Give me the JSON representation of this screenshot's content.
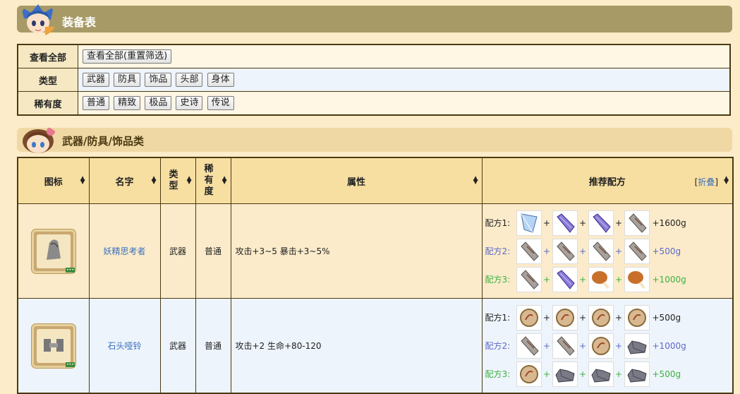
{
  "header": {
    "title": "装备表"
  },
  "filters": {
    "rows": [
      {
        "label": "查看全部",
        "options": [
          "查看全部(重置筛选)"
        ]
      },
      {
        "label": "类型",
        "options": [
          "武器",
          "防具",
          "饰品",
          "头部",
          "身体"
        ]
      },
      {
        "label": "稀有度",
        "options": [
          "普通",
          "精致",
          "极品",
          "史诗",
          "传说"
        ]
      }
    ]
  },
  "section": {
    "title": "武器/防具/饰品类"
  },
  "table": {
    "headers": {
      "icon": "图标",
      "name": "名字",
      "type": "类型",
      "rarity": "稀有度",
      "attr": "属性",
      "recipe": "推荐配方"
    },
    "collapse": "折叠",
    "rows": [
      {
        "name": "妖精思考者",
        "type": "武器",
        "rarity": "普通",
        "attr": "攻击+3~5 暴击+3~5%",
        "recipes": [
          {
            "label": "配方1:",
            "mats": [
              "crystal",
              "purple-bar",
              "purple-bar",
              "stone-slab"
            ],
            "gold": "+1600g"
          },
          {
            "label": "配方2:",
            "mats": [
              "stone-slab",
              "stone-slab",
              "stone-slab",
              "stone-slab"
            ],
            "gold": "+500g"
          },
          {
            "label": "配方3:",
            "mats": [
              "stone-slab",
              "purple-bar",
              "meat",
              "meat"
            ],
            "gold": "+1000g"
          }
        ]
      },
      {
        "name": "石头哑铃",
        "type": "武器",
        "rarity": "普通",
        "attr": "攻击+2 生命+80-120",
        "recipes": [
          {
            "label": "配方1:",
            "mats": [
              "leather",
              "leather",
              "leather",
              "leather"
            ],
            "gold": "+500g"
          },
          {
            "label": "配方2:",
            "mats": [
              "stone-slab",
              "stone-slab",
              "leather",
              "iron-ore"
            ],
            "gold": "+1000g"
          },
          {
            "label": "配方3:",
            "mats": [
              "leather",
              "iron-ore",
              "iron-ore",
              "iron-ore"
            ],
            "gold": "+500g"
          }
        ]
      }
    ]
  }
}
